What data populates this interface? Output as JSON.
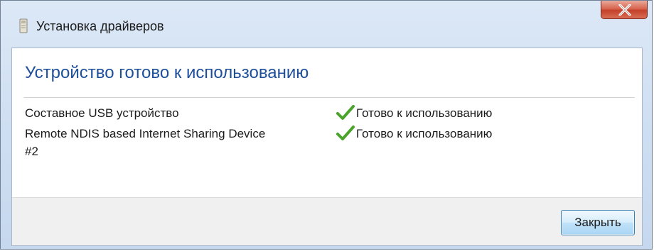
{
  "window": {
    "title": "Установка драйверов",
    "icons": {
      "app": "driver-install-icon",
      "close": "close-icon"
    }
  },
  "main": {
    "heading": "Устройство готово к использованию",
    "devices": [
      {
        "name": "Составное USB устройство",
        "status": "Готово к использованию",
        "status_icon": "checkmark-icon"
      },
      {
        "name": "Remote NDIS based Internet Sharing Device",
        "name_cont": "#2",
        "status": "Готово к использованию",
        "status_icon": "checkmark-icon"
      }
    ]
  },
  "footer": {
    "close_label": "Закрыть"
  },
  "colors": {
    "heading": "#1e4f9a",
    "check": "#4aa32a",
    "close_button": "#c4412a"
  }
}
